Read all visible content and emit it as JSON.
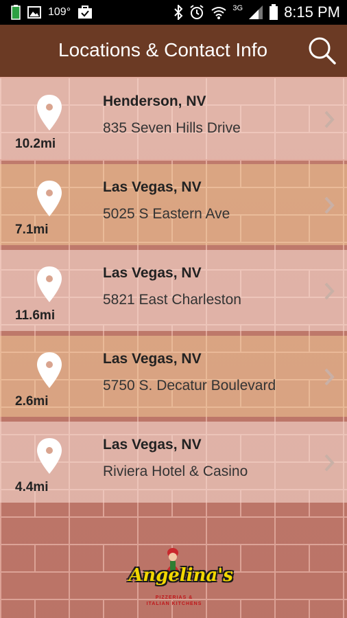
{
  "status_bar": {
    "temperature": "109°",
    "network": "3G",
    "time": "8:15 PM"
  },
  "app_bar": {
    "title": "Locations & Contact Info",
    "search_icon": "search-icon"
  },
  "locations": [
    {
      "city": "Henderson, NV",
      "address": "835 Seven Hills Drive",
      "distance": "10.2mi"
    },
    {
      "city": "Las Vegas, NV",
      "address": "5025 S Eastern Ave",
      "distance": "7.1mi"
    },
    {
      "city": "Las Vegas, NV",
      "address": "5821 East Charleston",
      "distance": "11.6mi"
    },
    {
      "city": "Las Vegas, NV",
      "address": "5750 S. Decatur Boulevard",
      "distance": "2.6mi"
    },
    {
      "city": "Las Vegas, NV",
      "address": "Riviera Hotel & Casino",
      "distance": "4.4mi"
    }
  ],
  "logo": {
    "name": "Angelina's",
    "tagline_1": "PIZZERIAS &",
    "tagline_2": "ITALIAN KITCHENS"
  },
  "colors": {
    "app_bar": "#6b3a24",
    "status_bar": "#000000",
    "pin": "#ffffff"
  }
}
